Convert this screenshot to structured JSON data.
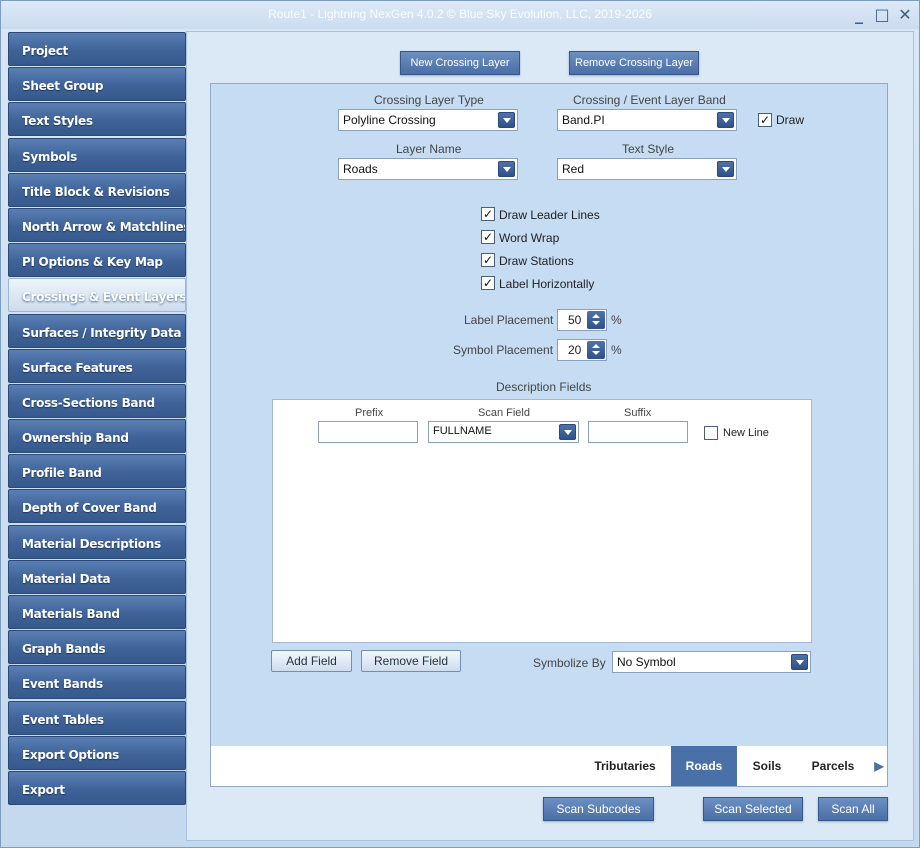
{
  "window": {
    "title": "Route1 - Lightning NexGen 4.0.2 © Blue Sky Evolution, LLC, 2019-2026",
    "minimize": "_",
    "maximize": "□",
    "close": "✕"
  },
  "sidebar": {
    "items": [
      {
        "label": "Project"
      },
      {
        "label": "Sheet Group"
      },
      {
        "label": "Text Styles"
      },
      {
        "label": "Symbols"
      },
      {
        "label": "Title Block & Revisions"
      },
      {
        "label": "North Arrow & Matchlines"
      },
      {
        "label": "PI Options & Key Map"
      },
      {
        "label": "Crossings & Event Layers",
        "active": true
      },
      {
        "label": "Surfaces / Integrity Data"
      },
      {
        "label": "Surface Features"
      },
      {
        "label": "Cross-Sections Band"
      },
      {
        "label": "Ownership Band"
      },
      {
        "label": "Profile Band"
      },
      {
        "label": "Depth of Cover Band"
      },
      {
        "label": "Material Descriptions"
      },
      {
        "label": "Material Data"
      },
      {
        "label": "Materials Band"
      },
      {
        "label": "Graph Bands"
      },
      {
        "label": "Event Bands"
      },
      {
        "label": "Event Tables"
      },
      {
        "label": "Export Options"
      },
      {
        "label": "Export"
      }
    ]
  },
  "toolbar": {
    "new_layer": "New Crossing Layer",
    "remove_layer": "Remove Crossing Layer"
  },
  "form": {
    "crossing_type_label": "Crossing Layer Type",
    "crossing_type_value": "Polyline Crossing",
    "band_label": "Crossing / Event Layer Band",
    "band_value": "Band.PI",
    "draw_label": "Draw",
    "draw_checked": true,
    "layer_name_label": "Layer Name",
    "layer_name_value": "Roads",
    "text_style_label": "Text Style",
    "text_style_value": "Red",
    "options": [
      {
        "label": "Draw Leader Lines",
        "checked": true
      },
      {
        "label": "Word Wrap",
        "checked": true
      },
      {
        "label": "Draw Stations",
        "checked": true
      },
      {
        "label": "Label Horizontally",
        "checked": true
      }
    ],
    "label_placement_label": "Label Placement",
    "label_placement_value": "50",
    "symbol_placement_label": "Symbol Placement",
    "symbol_placement_value": "20",
    "percent": "%",
    "description_fields_label": "Description Fields",
    "prefix_label": "Prefix",
    "scan_field_label": "Scan Field",
    "suffix_label": "Suffix",
    "scan_field_value": "FULLNAME",
    "new_line_label": "New Line",
    "add_field": "Add Field",
    "remove_field": "Remove Field",
    "symbolize_by_label": "Symbolize By",
    "symbolize_by_value": "No Symbol"
  },
  "tabs": [
    {
      "label": "Tributaries"
    },
    {
      "label": "Roads",
      "active": true
    },
    {
      "label": "Soils"
    },
    {
      "label": "Parcels"
    }
  ],
  "footer": {
    "scan_subcodes": "Scan Subcodes",
    "scan_selected": "Scan Selected",
    "scan_all": "Scan All"
  }
}
